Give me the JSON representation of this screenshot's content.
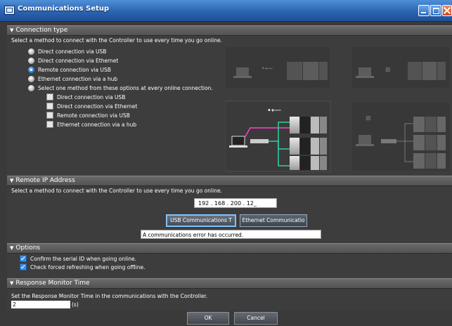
{
  "window": {
    "title": "Communications Setup"
  },
  "connection_type": {
    "header": "Connection type",
    "description": "Select a method to connect with the Controller to use every time you go online.",
    "options": [
      {
        "label": "Direct connection via USB",
        "selected": false
      },
      {
        "label": "Direct connection via Ethernet",
        "selected": false
      },
      {
        "label": "Remote connection via USB",
        "selected": true
      },
      {
        "label": "Ethernet connection via a hub",
        "selected": false
      },
      {
        "label": "Select one method from these options at every online connection.",
        "selected": false
      }
    ],
    "sub_options": [
      {
        "label": "Direct connection via USB",
        "checked": false
      },
      {
        "label": "Direct connection via Ethernet",
        "checked": false
      },
      {
        "label": "Remote connection via USB",
        "checked": false
      },
      {
        "label": "Ethernet connection via a hub",
        "checked": false
      }
    ]
  },
  "remote_ip": {
    "header": "Remote IP Address",
    "description": "Select a method to connect with the Controller to use every time you go online.",
    "ip_value": "192 . 168 . 200 . 12_",
    "buttons": [
      "USB Communications T",
      "Ethernet Communicatio"
    ],
    "status": "A communications error has occurred."
  },
  "options": {
    "header": "Options",
    "checks": [
      {
        "label": "Confirm the serial ID when going online.",
        "checked": true
      },
      {
        "label": "Check forced refreshing when going offline.",
        "checked": true
      }
    ]
  },
  "response_monitor": {
    "header": "Response Monitor Time",
    "description": "Set the Response Monitor Time in the communications with the Controller.",
    "value": "2",
    "unit": "(s)"
  },
  "footer": {
    "ok": "OK",
    "cancel": "Cancel"
  },
  "colors": {
    "title_bar": "#2a64b0",
    "background": "#3d3d3d",
    "section_header": "#5a5a5a",
    "accent": "#7fc2ff",
    "wire_green": "#2fd0a6",
    "wire_pink": "#ff3fd0"
  },
  "icons": [
    "app-icon",
    "minimize-icon",
    "maximize-icon",
    "close-icon",
    "usb-icon",
    "network-hub-icon",
    "laptop-icon",
    "controller-icon"
  ]
}
